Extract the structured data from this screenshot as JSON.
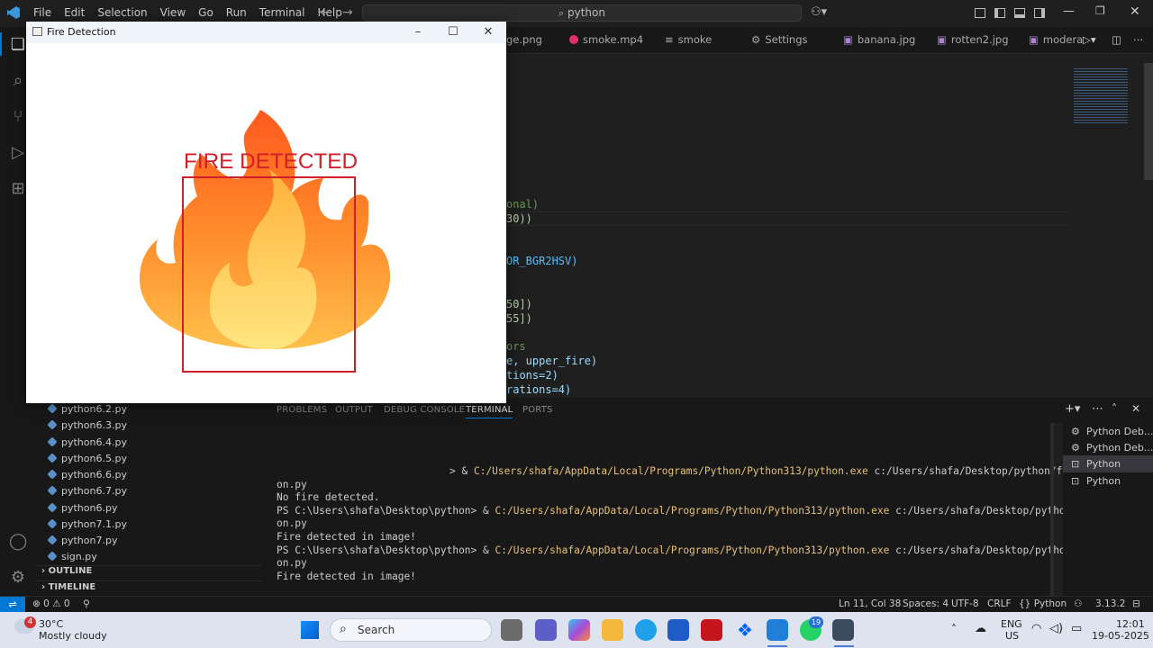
{
  "menu": [
    "File",
    "Edit",
    "Selection",
    "View",
    "Go",
    "Run",
    "Terminal",
    "Help"
  ],
  "search_text": "python",
  "tabs": [
    "ge.png",
    "smoke.mp4",
    "smoke",
    "Settings",
    "banana.jpg",
    "rotten2.jpg",
    "modera"
  ],
  "code_lines": [
    "onal)",
    "30))",
    "",
    "OR_BGR2HSV)",
    "",
    "50])",
    "55])",
    "ors",
    "e, upper_fire)",
    "tions=2)",
    "rations=4)"
  ],
  "sidebar": {
    "files": [
      "python6.2.py",
      "python6.3.py",
      "python6.4.py",
      "python6.5.py",
      "python6.6.py",
      "python6.7.py",
      "python6.py",
      "python7.1.py",
      "python7.py",
      "sign.py"
    ],
    "outline": "OUTLINE",
    "timeline": "TIMELINE"
  },
  "panel_tabs": [
    "PROBLEMS",
    "OUTPUT",
    "DEBUG CONSOLE",
    "TERMINAL",
    "PORTS"
  ],
  "terminal": {
    "prompt": "PS C:\\Users\\shafa\\Desktop\\python>",
    "amp": "& ",
    "exe": "C:/Users/shafa/AppData/Local/Programs/Python/Python313/python.exe",
    "script": "c:/Users/shafa/Desktop/python/firedetecti",
    "script_tail": "on.py",
    "out1": "No fire detected.",
    "out2": "Fire detected in image!",
    "out3": "Fire detected in image!",
    "first_prefix": "> "
  },
  "terminal_list": [
    "Python Deb...",
    "Python Deb...",
    "Python",
    "Python"
  ],
  "status": {
    "errors": "0",
    "warnings": "0",
    "position": "Ln 11, Col 38",
    "spaces": "Spaces: 4",
    "encoding": "UTF-8",
    "eol": "CRLF",
    "language": "Python",
    "python_version": "3.13.2"
  },
  "window": {
    "title": "Fire Detection",
    "overlay_text": "FIRE DETECTED",
    "overlay_color": "#d21e28"
  },
  "taskbar": {
    "weather_temp": "30°C",
    "weather_desc": "Mostly cloudy",
    "weather_badge": "4",
    "search": "Search",
    "whatsapp_badge": "19",
    "lang1": "ENG",
    "lang2": "US",
    "time": "12:01",
    "date": "19-05-2025"
  }
}
